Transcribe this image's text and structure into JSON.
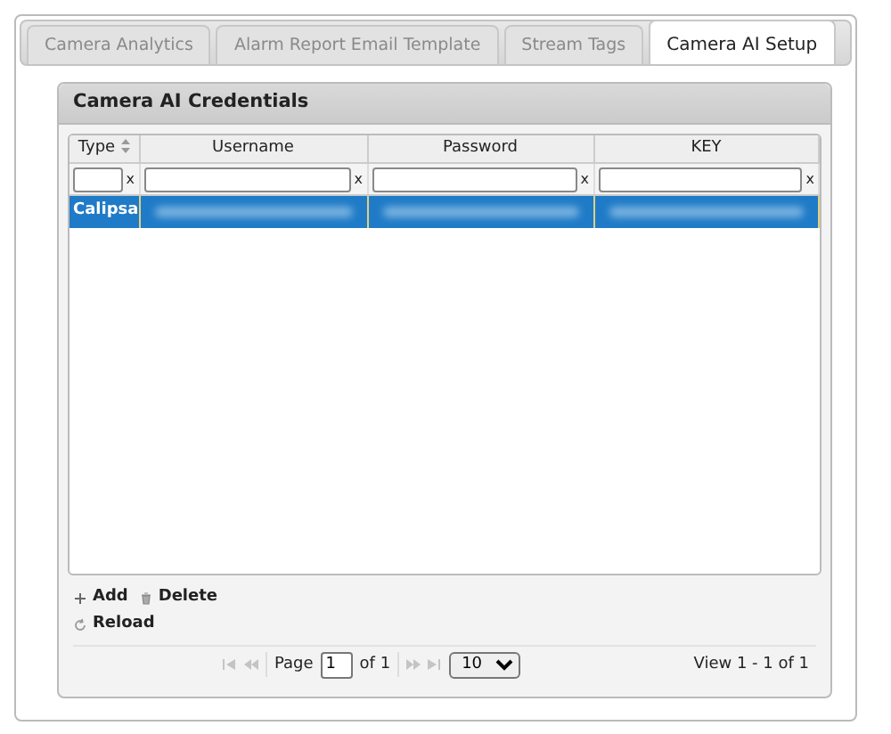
{
  "tabs": [
    {
      "label": "Camera Analytics",
      "selected": false
    },
    {
      "label": "Alarm Report Email Template",
      "selected": false
    },
    {
      "label": "Stream Tags",
      "selected": false
    },
    {
      "label": "Camera AI Setup",
      "selected": true
    }
  ],
  "panel": {
    "title": "Camera AI Credentials"
  },
  "table": {
    "columns": [
      {
        "label": "Type",
        "sortable": true
      },
      {
        "label": "Username",
        "sortable": false
      },
      {
        "label": "Password",
        "sortable": false
      },
      {
        "label": "KEY",
        "sortable": false
      }
    ],
    "filter_clear": [
      "x",
      "x",
      "x",
      "x"
    ],
    "rows": [
      {
        "selected": true,
        "cells": [
          {
            "kind": "text",
            "text": "Calipsa"
          },
          {
            "kind": "blurred"
          },
          {
            "kind": "blurred"
          },
          {
            "kind": "blurred"
          }
        ]
      }
    ]
  },
  "toolbar": [
    {
      "kind": "add",
      "label": "Add"
    },
    {
      "kind": "delete",
      "label": "Delete"
    },
    {
      "kind": "reload",
      "label": "Reload"
    }
  ],
  "pager": {
    "page_label": "Page",
    "page": "1",
    "of_label": "of 1",
    "page_size": "10",
    "view": "View 1 - 1 of 1"
  }
}
